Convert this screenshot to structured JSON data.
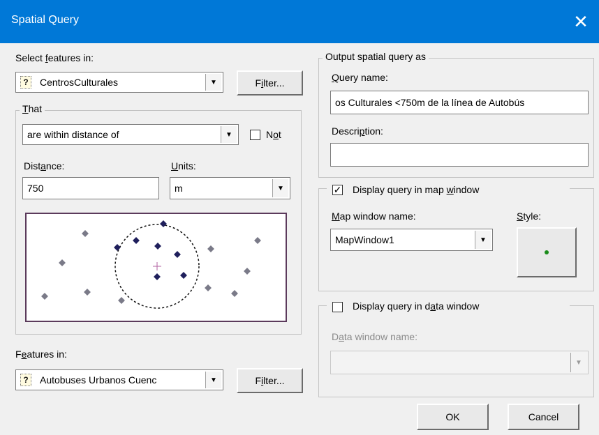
{
  "window": {
    "title": "Spatial Query",
    "close_symbol": "✕"
  },
  "select": {
    "label_pre": "Select ",
    "label_u": "f",
    "label_post": "eatures in:",
    "layer": "CentrosCulturales",
    "layer_icon": "?",
    "filter_pre": "F",
    "filter_u": "i",
    "filter_post": "lter..."
  },
  "that": {
    "legend_u": "T",
    "legend_post": "hat",
    "condition": "are within distance of",
    "not_pre": "N",
    "not_u": "o",
    "not_post": "t",
    "not_checked": false,
    "distance_label_pre": "Dist",
    "distance_label_u": "a",
    "distance_label_post": "nce:",
    "distance_value": "750",
    "units_label_u": "U",
    "units_label_post": "nits:",
    "units_value": "m"
  },
  "features": {
    "label_pre": "F",
    "label_u": "e",
    "label_post": "atures in:",
    "layer": "Autobuses Urbanos Cuenc",
    "layer_icon": "?",
    "filter_pre": "F",
    "filter_u": "i",
    "filter_post": "lter..."
  },
  "output": {
    "legend": "Output spatial query as",
    "query_name_label_u": "Q",
    "query_name_label_post": "uery name:",
    "query_name_value": "os Culturales <750m de la línea de Autobús",
    "description_label_pre": "Descri",
    "description_label_u": "p",
    "description_label_post": "tion:",
    "description_value": ""
  },
  "map": {
    "checkbox_checked": true,
    "checkbox_mark": "✓",
    "label_pre": "Display query in map ",
    "label_u": "w",
    "label_post": "indow",
    "name_label_u": "M",
    "name_label_post": "ap window name:",
    "name_value": "MapWindow1",
    "style_label_u": "S",
    "style_label_post": "tyle:"
  },
  "data": {
    "checkbox_checked": false,
    "label_pre": "Display query in d",
    "label_u": "a",
    "label_post": "ta window",
    "name_label_pre": "D",
    "name_label_u": "a",
    "name_label_post": "ta window name:",
    "name_value": ""
  },
  "buttons": {
    "ok": "OK",
    "cancel": "Cancel"
  },
  "icons": {
    "dropdown": "▼",
    "query_layer": "question-mark-icon",
    "preview": "spatial-preview-icon",
    "style": "point-style-icon"
  },
  "colors": {
    "titlebar": "#0078d7",
    "selected_point": "#1f1f5c",
    "other_point": "#7a7a88",
    "style_dot": "#1a8c1a",
    "preview_border": "#5b3a5b"
  }
}
